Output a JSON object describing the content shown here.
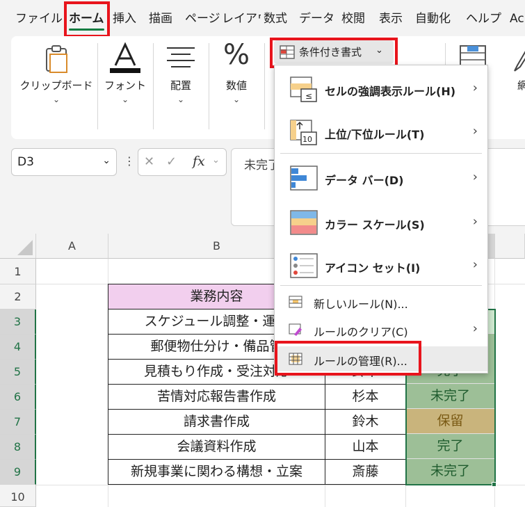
{
  "tabs": [
    "ファイル",
    "ホーム",
    "挿入",
    "描画",
    "ページ",
    "レイアウ",
    "数式",
    "データ",
    "校閲",
    "表示",
    "自動化",
    "ヘルプ",
    "Ac"
  ],
  "ribbon": {
    "clipboard": "クリップボード",
    "font": "フォント",
    "align": "配置",
    "number": "数値",
    "conditional_format": "条件付き書式",
    "cell_style_partial": "網"
  },
  "formula_bar": {
    "name_box": "D3",
    "fx": "fx",
    "content": "未完了"
  },
  "dropdown": {
    "items": [
      {
        "label": "セルの強調表示ルール(H)"
      },
      {
        "label": "上位/下位ルール(T)"
      },
      {
        "label": "データ バー(D)"
      },
      {
        "label": "カラー スケール(S)"
      },
      {
        "label": "アイコン セット(I)"
      }
    ],
    "small_items": [
      {
        "label": "新しいルール(N)..."
      },
      {
        "label": "ルールのクリア(C)"
      },
      {
        "label": "ルールの管理(R)..."
      }
    ]
  },
  "sheet": {
    "columns": [
      "A",
      "B"
    ],
    "rows": [
      "1",
      "2",
      "3",
      "4",
      "5",
      "6",
      "7",
      "8",
      "9",
      "10"
    ],
    "header": "業務内容",
    "tasks": [
      "スケジュール調整・運営",
      "郵便物仕分け・備品管",
      "見積もり作成・受注対応",
      "苦情対応報告書作成",
      "請求書作成",
      "会議資料作成",
      "新規事業に関わる構想・立案"
    ],
    "persons": [
      "",
      "",
      "鈴木",
      "杉本",
      "鈴木",
      "山本",
      "斎藤"
    ],
    "statuses": [
      "",
      "",
      "完了",
      "未完了",
      "保留",
      "完了",
      "未完了"
    ]
  },
  "colors": {
    "accent": "#107c41",
    "highlight_red": "#e8141c",
    "header_fill": "#f2cfee",
    "status_green": "#9dbf97",
    "status_hold": "#c9b47c"
  }
}
